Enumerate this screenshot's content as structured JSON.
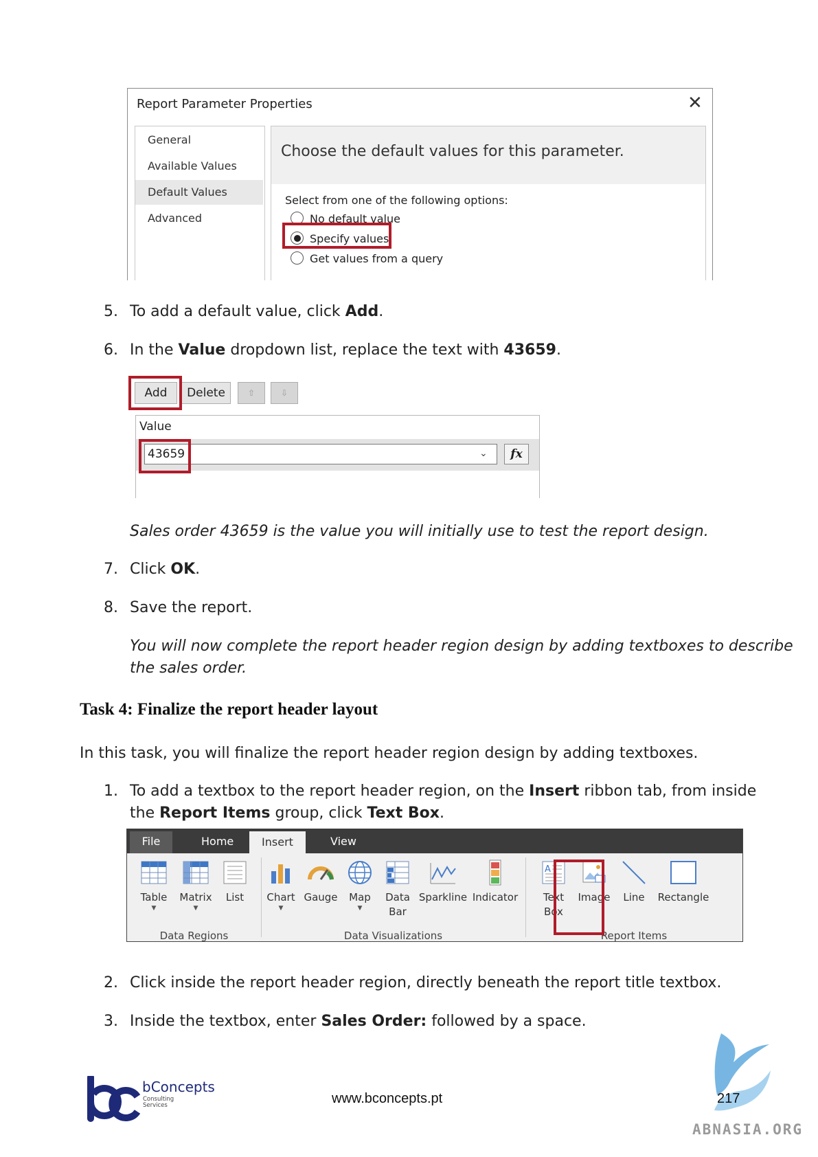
{
  "dialog": {
    "title": "Report Parameter Properties",
    "close_glyph": "✕",
    "nav": [
      "General",
      "Available Values",
      "Default Values",
      "Advanced"
    ],
    "heading": "Choose the default values for this parameter.",
    "prompt": "Select from one of the following options:",
    "options": [
      "No default value",
      "Specify values",
      "Get values from a query"
    ],
    "selected_option": "Specify values"
  },
  "steps_a": {
    "s5_num": "5.",
    "s5_pre": "To add a default value, click ",
    "s5_bold": "Add",
    "s5_post": ".",
    "s6_num": "6.",
    "s6_pre": "In the ",
    "s6_bold1": "Value",
    "s6_mid": " dropdown list, replace the text with ",
    "s6_bold2": "43659",
    "s6_post": "."
  },
  "value_editor": {
    "add_label": "Add",
    "delete_label": "Delete",
    "up_glyph": "⇧",
    "down_glyph": "⇩",
    "column_header": "Value",
    "value": "43659",
    "fx_label": "fx",
    "chevron": "⌄"
  },
  "note1": "Sales order 43659 is the value you will initially use to test the report design.",
  "steps_b": {
    "s7_num": "7.",
    "s7_pre": "Click ",
    "s7_bold": "OK",
    "s7_post": ".",
    "s8_num": "8.",
    "s8_text": "Save the report."
  },
  "note2_line1": "You will now complete the report header region design by adding textboxes to describe",
  "note2_line2": "the sales order.",
  "task_heading": "Task 4: Finalize the report header layout",
  "task_intro": "In this task, you will finalize the report header region design by adding textboxes.",
  "steps_c": {
    "s1_num": "1.",
    "s1_l1_pre": "To add a textbox to the report header region, on the ",
    "s1_l1_bold": "Insert",
    "s1_l1_post": " ribbon tab, from inside",
    "s1_l2_pre": "the ",
    "s1_l2_bold1": "Report Items",
    "s1_l2_mid": " group, click ",
    "s1_l2_bold2": "Text Box",
    "s1_l2_post": "."
  },
  "ribbon": {
    "tabs": [
      "File",
      "Home",
      "Insert",
      "View"
    ],
    "active_tab": "Insert",
    "data_regions": [
      "Table",
      "Matrix",
      "List"
    ],
    "data_viz": [
      "Chart",
      "Gauge",
      "Map",
      "Data\nBar",
      "Sparkline",
      "Indicator"
    ],
    "report_items": [
      "Text\nBox",
      "Image",
      "Line",
      "Rectangle"
    ],
    "group_labels": [
      "Data Regions",
      "Data Visualizations",
      "Report Items"
    ]
  },
  "steps_d": {
    "s2_num": "2.",
    "s2_text": "Click inside the report header region, directly beneath the report title textbox.",
    "s3_num": "3.",
    "s3_pre": "Inside the textbox, enter ",
    "s3_bold": "Sales Order:",
    "s3_post": " followed by a space."
  },
  "footer": {
    "logo_name": "bConcepts",
    "logo_sub1": "Consulting",
    "logo_sub2": "Services",
    "url": "www.bconcepts.pt",
    "page": "217",
    "watermark": "ABNASIA.ORG"
  },
  "colors": {
    "highlight": "#b01c2a",
    "logo_blue": "#1e2a78",
    "ribbon_dark": "#3b3b3b"
  }
}
